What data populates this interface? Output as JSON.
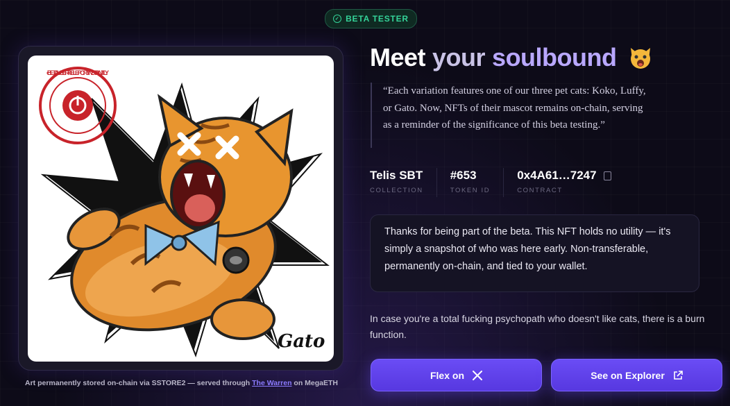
{
  "badge": {
    "label": "BETA TESTER",
    "icon": "check-circle-icon"
  },
  "heading": {
    "word1": "Meet",
    "word2": "your",
    "word3": "soulbound",
    "emoji": "cat-face-emoji"
  },
  "quote": "“Each variation features one of our three pet cats: Koko, Luffy, or Gato. Now, NFTs of their mascot remains on-chain, serving as a reminder of the significance of this beta testing.”",
  "stats": [
    {
      "value": "Telis SBT",
      "label": "COLLECTION"
    },
    {
      "value": "#653",
      "label": "TOKEN ID"
    },
    {
      "value": "0x4A61…7247",
      "label": "CONTRACT",
      "icon": "copy-icon"
    }
  ],
  "note": "Thanks for being part of the beta. This NFT holds no utility — it's simply a snapshot of who was here early. Non-transferable, permanently on-chain, and tied to your wallet.",
  "burn_text": "In case you're a total fucking psychopath who doesn't like cats, there is a burn function.",
  "buttons": {
    "flex_label": "Flex on",
    "flex_icon": "x-logo-icon",
    "explorer_label": "See on Explorer",
    "explorer_icon": "external-link-icon"
  },
  "artwork": {
    "stamp_text": "• BETA USER • TELEPORT INSTANTLY",
    "signature": "Gato"
  },
  "caption": {
    "prefix": "Art permanently stored on-chain via SSTORE2 — served through ",
    "link": "The Warren",
    "suffix": " on MegaETH"
  },
  "colors": {
    "accent": "#6a4cf5",
    "badge_green": "#34d399",
    "background": "#0d0b18"
  }
}
